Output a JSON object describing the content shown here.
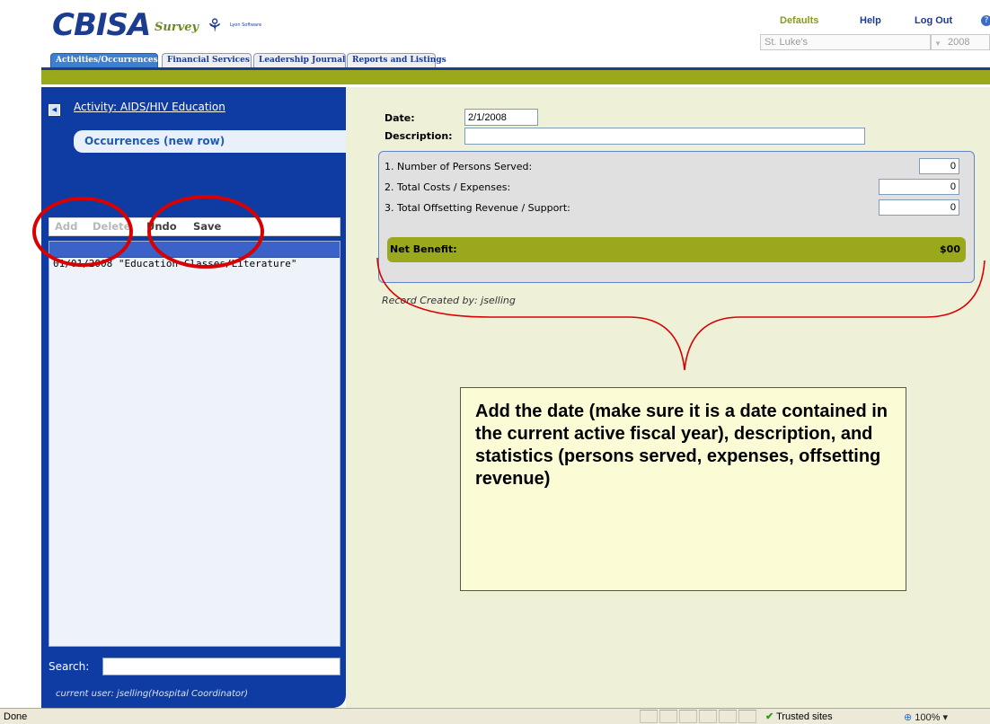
{
  "header": {
    "logo_main": "CBISA",
    "logo_survey": "Survey",
    "logo_vendor": "Lyon Software",
    "links": {
      "defaults": "Defaults",
      "help": "Help",
      "logout": "Log Out"
    },
    "hospital_select": "St. Luke's",
    "year_select": "2008",
    "tabs": [
      {
        "label": "Activities/Occurrences",
        "active": true
      },
      {
        "label": "Financial Services"
      },
      {
        "label": "Leadership Journal"
      },
      {
        "label": "Reports and Listings"
      }
    ]
  },
  "sidebar": {
    "activity_link": "Activity: AIDS/HIV Education",
    "occurrences_tab": "Occurrences (new row)",
    "toolbar": {
      "add": "Add",
      "delete": "Delete",
      "undo": "Undo",
      "save": "Save"
    },
    "list_items": [
      "01/01/2008  \"Education Classes/Literature\""
    ],
    "search_label": "Search:",
    "search_value": "",
    "current_user": "current user: jselling(Hospital Coordinator)"
  },
  "form": {
    "date_label": "Date:",
    "date_value": "2/1/2008",
    "description_label": "Description:",
    "description_value": "",
    "stats": [
      {
        "label": "1. Number of Persons Served:",
        "value": "0"
      },
      {
        "label": "2. Total Costs / Expenses:",
        "value": "0"
      },
      {
        "label": "3. Total Offsetting Revenue / Support:",
        "value": "0"
      }
    ],
    "net_benefit_label": "Net Benefit:",
    "net_benefit_value": "$00",
    "record_created": "Record Created by: jselling"
  },
  "annotation": {
    "callout_text": "Add the date (make sure it is a date contained in the current active fiscal year), description, and statistics (persons served, expenses, offsetting revenue)"
  },
  "statusbar": {
    "status": "Done",
    "zone": "Trusted sites",
    "zoom": "100%"
  },
  "colors": {
    "primary_blue": "#0f3ca3",
    "olive": "#9aa81c",
    "content_bg": "#eef0d8",
    "annotation_red": "#d90000"
  }
}
